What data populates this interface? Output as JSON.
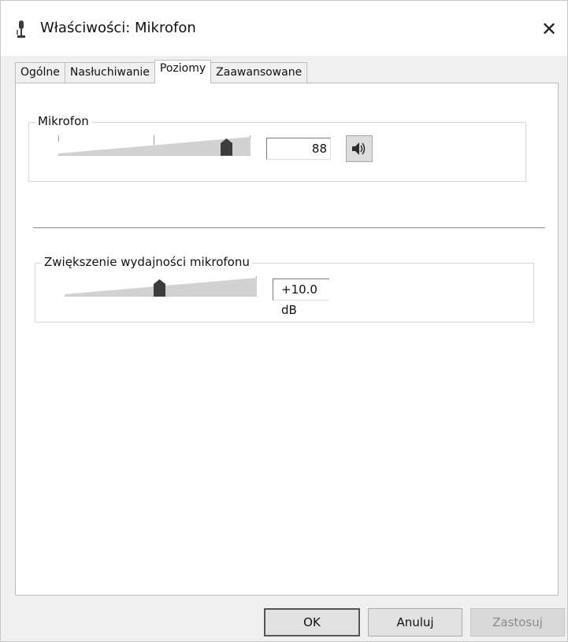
{
  "window": {
    "title": "Właściwości: Mikrofon",
    "close_glyph": "✕",
    "icon": "microphone-icon"
  },
  "tabs": [
    {
      "label": "Ogólne",
      "active": false
    },
    {
      "label": "Nasłuchiwanie",
      "active": false
    },
    {
      "label": "Poziomy",
      "active": true
    },
    {
      "label": "Zaawansowane",
      "active": false
    }
  ],
  "levels": {
    "microphone": {
      "label": "Mikrofon",
      "value": "88",
      "slider_level": 0.88,
      "mute_icon": "speaker-icon"
    },
    "boost": {
      "label": "Zwiększenie wydajności mikrofonu",
      "value": "+10.0 dB",
      "slider_level": 0.5
    }
  },
  "buttons": {
    "ok": "OK",
    "cancel": "Anuluj",
    "apply": "Zastosuj"
  }
}
